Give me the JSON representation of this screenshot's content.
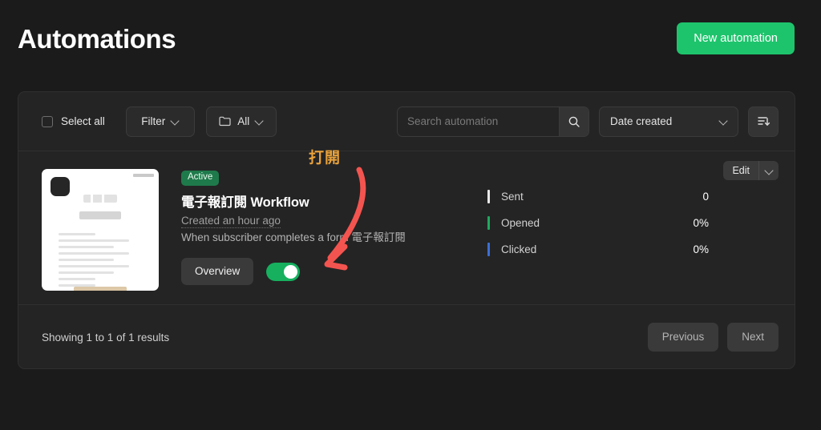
{
  "header": {
    "title": "Automations",
    "new_button": "New automation"
  },
  "toolbar": {
    "select_all_label": "Select all",
    "filter_label": "Filter",
    "folder_label": "All",
    "folder_icon": "folder-icon",
    "search_placeholder": "Search automation",
    "search_value": "",
    "search_icon": "search-icon",
    "sort_select_value": "Date created",
    "sort_order_icon": "sort-descending-icon",
    "chevron_icon": "chevron-down-icon"
  },
  "automation": {
    "status_badge": "Active",
    "title": "電子報訂閱 Workflow",
    "created": "Created an hour ago",
    "description": "When subscriber completes a form 電子報訂閱",
    "overview_button": "Overview",
    "toggle_state": "on",
    "edit_button": "Edit",
    "edit_caret_icon": "chevron-down-icon",
    "thumbnail_alt": "email-preview-thumbnail",
    "stats": [
      {
        "label": "Sent",
        "value": "0",
        "color": "#e8e8e8"
      },
      {
        "label": "Opened",
        "value": "0%",
        "color": "#1fa95f"
      },
      {
        "label": "Clicked",
        "value": "0%",
        "color": "#3b6fd4"
      }
    ]
  },
  "footer": {
    "results_text": "Showing 1 to 1 of 1 results",
    "previous_label": "Previous",
    "next_label": "Next"
  },
  "annotations": {
    "label": "打開",
    "label_color": "#e9a23b",
    "arrow_color": "#f4544f",
    "arrow_name": "annotation-arrow-to-toggle"
  },
  "colors": {
    "page_background": "#1b1b1b",
    "card_background": "#242424",
    "accent_green": "#1ec46c",
    "badge_green": "#1f7a4b"
  }
}
